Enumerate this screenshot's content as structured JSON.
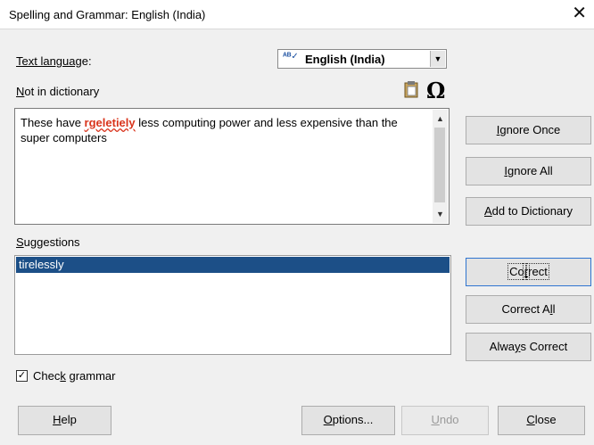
{
  "title": "Spelling and Grammar: English (India)",
  "close_glyph": "✕",
  "text_language": {
    "label_underlined": "Text languag",
    "label_rest": "e:",
    "value": "English (India)"
  },
  "not_in_dictionary": {
    "label_underlined": "N",
    "label_rest": "ot in dictionary"
  },
  "sentence": {
    "before": "These have ",
    "error_word": "rgeletiely",
    "after": " less computing power and less expensive than the super computers"
  },
  "suggestions": {
    "label_underlined": "S",
    "label_rest": "uggestions",
    "items": [
      "tirelessly"
    ]
  },
  "buttons": {
    "ignore_once": {
      "ul": "I",
      "rest": "gnore Once"
    },
    "ignore_all": {
      "ul": "I",
      "rest": "gnore All"
    },
    "add_to_dictionary": {
      "ul": "A",
      "rest": "dd to Dictionary"
    },
    "correct": {
      "pre": "Co",
      "ul": "r",
      "rest": "rect"
    },
    "correct_all": {
      "pre": "Correct A",
      "ul": "l",
      "rest": "l"
    },
    "always_correct": {
      "pre": "Alwa",
      "ul": "y",
      "rest": "s Correct"
    },
    "help": {
      "ul": "H",
      "rest": "elp"
    },
    "options": {
      "ul": "O",
      "rest": "ptions..."
    },
    "undo": {
      "ul": "U",
      "rest": "ndo"
    },
    "close": {
      "ul": "C",
      "rest": "lose"
    }
  },
  "check_grammar": {
    "pre": "Chec",
    "ul": "k",
    "rest": " grammar",
    "checked": true,
    "mark": "✓"
  },
  "icons": {
    "autocorrect": "autocorrect-icon",
    "clipboard": "clipboard-icon",
    "special_character": "omega-icon"
  },
  "colors": {
    "selection": "#1c4f87",
    "error": "#d9341c",
    "focus": "#2f74d0"
  }
}
